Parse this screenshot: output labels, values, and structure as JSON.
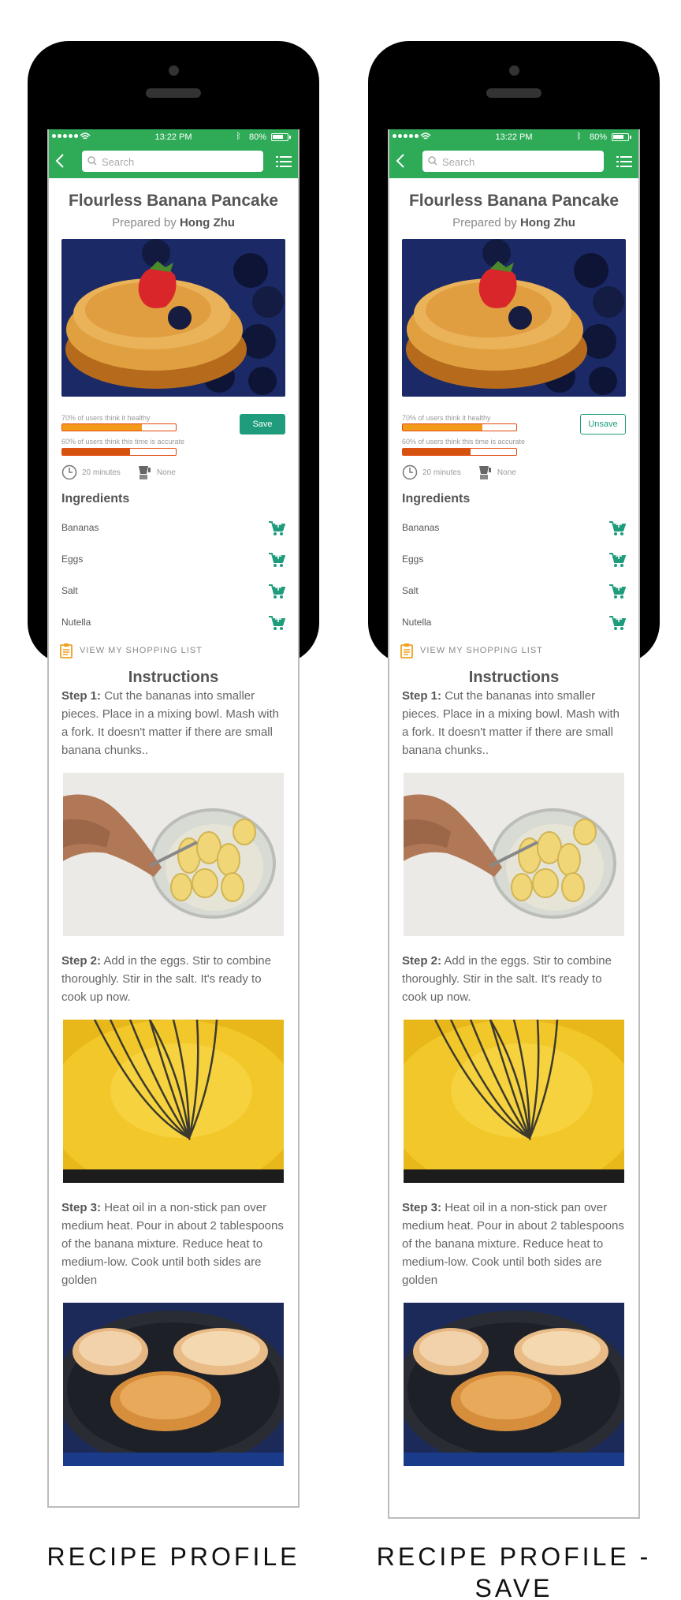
{
  "screens": [
    {
      "status": {
        "time": "13:22 PM",
        "battery": "80%"
      },
      "search_placeholder": "Search",
      "title": "Flourless Banana Pancake",
      "prepared_prefix": "Prepared by",
      "author": "Hong Zhu",
      "stats": {
        "healthy_label": "70% of users think it healthy",
        "healthy_fraction": 0.7,
        "accurate_label": "60% of users think this time is accurate",
        "accurate_fraction": 0.6
      },
      "save_label": "Save",
      "time": "20 minutes",
      "tools": "None",
      "ingredients_heading": "Ingredients",
      "ingredients": [
        "Bananas",
        "Eggs",
        "Salt",
        "Nutella"
      ],
      "shopping_link": "VIEW MY SHOPPING LIST",
      "instructions_heading": "Instructions",
      "steps": [
        {
          "label": "Step 1:",
          "text": "Cut the bananas into smaller pieces. Place in a mixing bowl. Mash with a fork. It doesn't matter if there are small banana chunks.."
        },
        {
          "label": "Step 2:",
          "text": "Add in the eggs. Stir to combine thoroughly. Stir in the salt. It's ready to cook up now."
        },
        {
          "label": "Step 3:",
          "text": "Heat oil in a non-stick pan over medium heat. Pour in about 2 tablespoons of the banana mixture. Reduce heat to medium-low. Cook until both sides are golden"
        }
      ]
    },
    {
      "status": {
        "time": "13:22 PM",
        "battery": "80%"
      },
      "search_placeholder": "Search",
      "title": "Flourless Banana Pancake",
      "prepared_prefix": "Prepared by",
      "author": "Hong Zhu",
      "stats": {
        "healthy_label": "70% of users think it healthy",
        "healthy_fraction": 0.7,
        "accurate_label": "60% of users think this time is accurate",
        "accurate_fraction": 0.6
      },
      "save_label": "Unsave",
      "time": "20 minutes",
      "tools": "None",
      "ingredients_heading": "Ingredients",
      "ingredients": [
        "Bananas",
        "Eggs",
        "Salt",
        "Nutella"
      ],
      "shopping_link": "VIEW MY SHOPPING LIST",
      "instructions_heading": "Instructions",
      "steps": [
        {
          "label": "Step 1:",
          "text": "Cut the bananas into smaller pieces. Place in a mixing bowl. Mash with a fork. It doesn't matter if there are small banana chunks.."
        },
        {
          "label": "Step 2:",
          "text": "Add in the eggs. Stir to combine thoroughly. Stir in the salt. It's ready to cook up now."
        },
        {
          "label": "Step 3:",
          "text": "Heat oil in a non-stick pan over medium heat. Pour in about 2 tablespoons of the banana mixture. Reduce heat to medium-low. Cook until both sides are golden"
        }
      ]
    }
  ],
  "captions": {
    "left": "RECIPE PROFILE",
    "right_line1": "RECIPE PROFILE -",
    "right_line2": "SAVE"
  },
  "colors": {
    "brand_green": "#2fab58",
    "save_teal": "#1e9c7c",
    "bar_orange": "#f29a1a",
    "bar_dark": "#d4520d"
  }
}
